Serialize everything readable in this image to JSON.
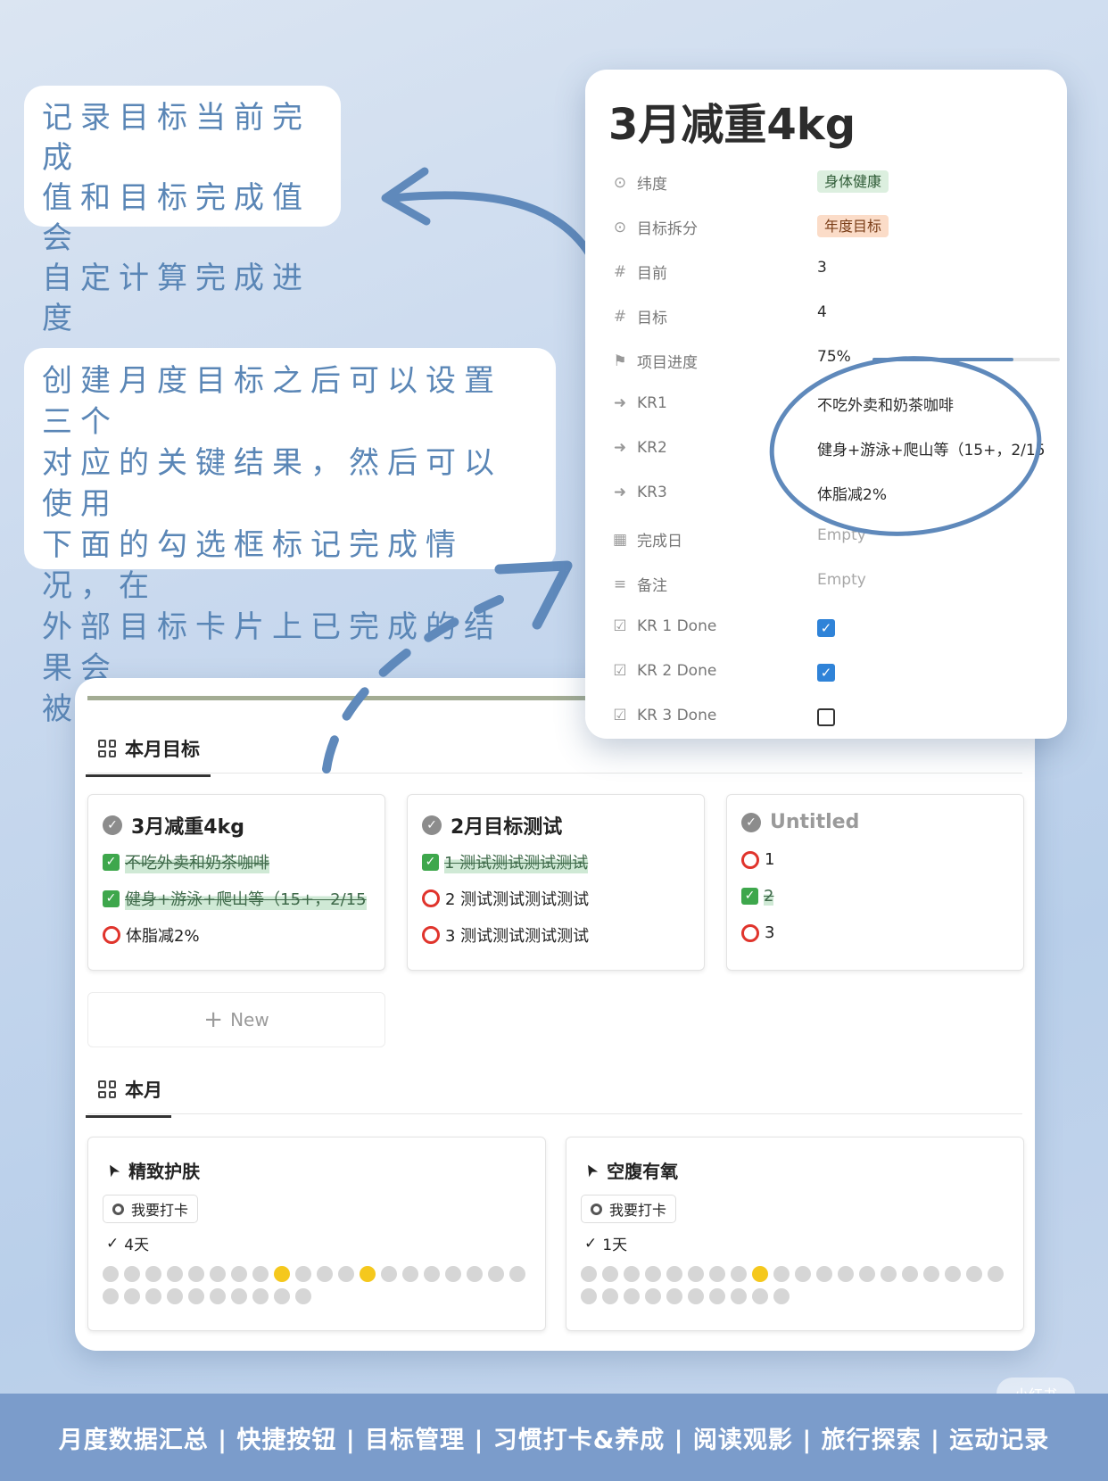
{
  "notes": {
    "note1": [
      "记录目标当前完成",
      "值和目标完成值会",
      "自定计算完成进度"
    ],
    "note2": [
      "创建月度目标之后可以设置三个",
      "对应的关键结果，然后可以使用",
      "下面的勾选框标记完成情况，在",
      "外部目标卡片上已完成的结果会",
      "被划线加高亮。"
    ]
  },
  "panel": {
    "title": "3月减重4kg",
    "props": [
      {
        "label": "纬度",
        "icon": "select-icon",
        "type": "tag",
        "value": "身体健康",
        "color": "#dcefdf"
      },
      {
        "label": "目标拆分",
        "icon": "select-icon",
        "type": "tag",
        "value": "年度目标",
        "color": "#fbdcc8"
      },
      {
        "label": "目前",
        "icon": "number-icon",
        "type": "text",
        "value": "3"
      },
      {
        "label": "目标",
        "icon": "number-icon",
        "type": "text",
        "value": "4"
      },
      {
        "label": "项目进度",
        "icon": "flag-icon",
        "type": "progress",
        "value": "75%",
        "fraction": 0.75
      },
      {
        "label": "KR1",
        "icon": "arrow-icon",
        "type": "text",
        "value": "不吃外卖和奶茶咖啡"
      },
      {
        "label": "KR2",
        "icon": "arrow-icon",
        "type": "text",
        "value": "健身+游泳+爬山等（15+，2/15"
      },
      {
        "label": "KR3",
        "icon": "arrow-icon",
        "type": "text",
        "value": "体脂减2%"
      },
      {
        "label": "完成日",
        "icon": "calendar-icon",
        "type": "empty",
        "value": "Empty"
      },
      {
        "label": "备注",
        "icon": "text-icon",
        "type": "empty",
        "value": "Empty"
      },
      {
        "label": "KR 1 Done",
        "icon": "checkbox-icon",
        "type": "check",
        "checked": true
      },
      {
        "label": "KR 2 Done",
        "icon": "checkbox-icon",
        "type": "check",
        "checked": true
      },
      {
        "label": "KR 3 Done",
        "icon": "checkbox-icon",
        "type": "check",
        "checked": false
      }
    ]
  },
  "board": {
    "tab1": "本月目标",
    "goals": [
      {
        "title": "3月减重4kg",
        "krs": [
          {
            "text": "不吃外卖和奶茶咖啡",
            "done": true
          },
          {
            "text": "健身+游泳+爬山等（15+，2/15",
            "done": true
          },
          {
            "text": "体脂减2%",
            "done": false
          }
        ]
      },
      {
        "title": "2月目标测试",
        "krs": [
          {
            "text": "1 测试测试测试测试",
            "done": true
          },
          {
            "text": "2 测试测试测试测试",
            "done": false
          },
          {
            "text": "3 测试测试测试测试",
            "done": false
          }
        ]
      },
      {
        "title": "Untitled",
        "krs": [
          {
            "text": "1",
            "done": false
          },
          {
            "text": "2",
            "done": true
          },
          {
            "text": "3",
            "done": false
          }
        ]
      }
    ],
    "new_label": "New",
    "tab2": "本月",
    "habits": [
      {
        "title": "精致护肤",
        "button": "我要打卡",
        "days": "4天",
        "dots_total": 30,
        "dots_on": [
          8,
          12
        ]
      },
      {
        "title": "空腹有氧",
        "button": "我要打卡",
        "days": "1天",
        "dots_total": 30,
        "dots_on": [
          8
        ]
      }
    ]
  },
  "footer": "月度数据汇总 | 快捷按钮 | 目标管理 | 习惯打卡&养成 | 阅读观影 | 旅行探索 | 运动记录",
  "watermark": "小红书"
}
